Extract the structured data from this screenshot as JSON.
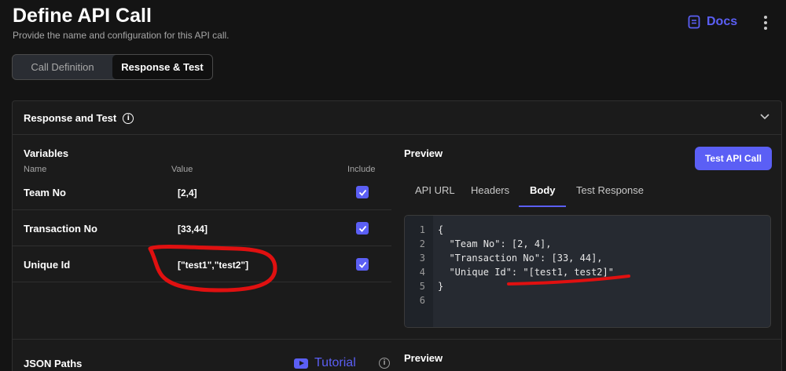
{
  "header": {
    "title": "Define API Call",
    "subtitle": "Provide the name and configuration for this API call.",
    "docs_label": "Docs"
  },
  "top_tabs": [
    {
      "label": "Call Definition",
      "active": false
    },
    {
      "label": "Response & Test",
      "active": true
    }
  ],
  "panel": {
    "title": "Response and Test",
    "variables": {
      "title": "Variables",
      "columns": {
        "name": "Name",
        "value": "Value",
        "include": "Include"
      },
      "rows": [
        {
          "name": "Team No",
          "value": "[2,4]",
          "include": true
        },
        {
          "name": "Transaction No",
          "value": "[33,44]",
          "include": true
        },
        {
          "name": "Unique Id",
          "value": "[\"test1\",\"test2\"]",
          "include": true
        }
      ]
    },
    "preview": {
      "title": "Preview",
      "test_button": "Test API Call",
      "tabs": [
        {
          "label": "API URL",
          "active": false
        },
        {
          "label": "Headers",
          "active": false
        },
        {
          "label": "Body",
          "active": true
        },
        {
          "label": "Test Response",
          "active": false
        }
      ],
      "code_lines": [
        {
          "n": "1",
          "text": "{"
        },
        {
          "n": "2",
          "text": "  \"Team No\": [2, 4],"
        },
        {
          "n": "3",
          "text": "  \"Transaction No\": [33, 44],"
        },
        {
          "n": "4",
          "text": "  \"Unique Id\": \"[test1, test2]\""
        },
        {
          "n": "5",
          "text": "}"
        },
        {
          "n": "6",
          "text": ""
        }
      ]
    },
    "json_paths": {
      "title": "JSON Paths",
      "tutorial_label": "Tutorial",
      "preview_title": "Preview"
    }
  },
  "colors": {
    "accent": "#5b5ff5",
    "background": "#141414",
    "panel": "#1b1b1b",
    "annotation": "#e01010"
  },
  "icons": [
    "docs-icon",
    "more-vert-icon",
    "info-icon",
    "chevron-down-icon",
    "check-icon",
    "youtube-icon"
  ]
}
